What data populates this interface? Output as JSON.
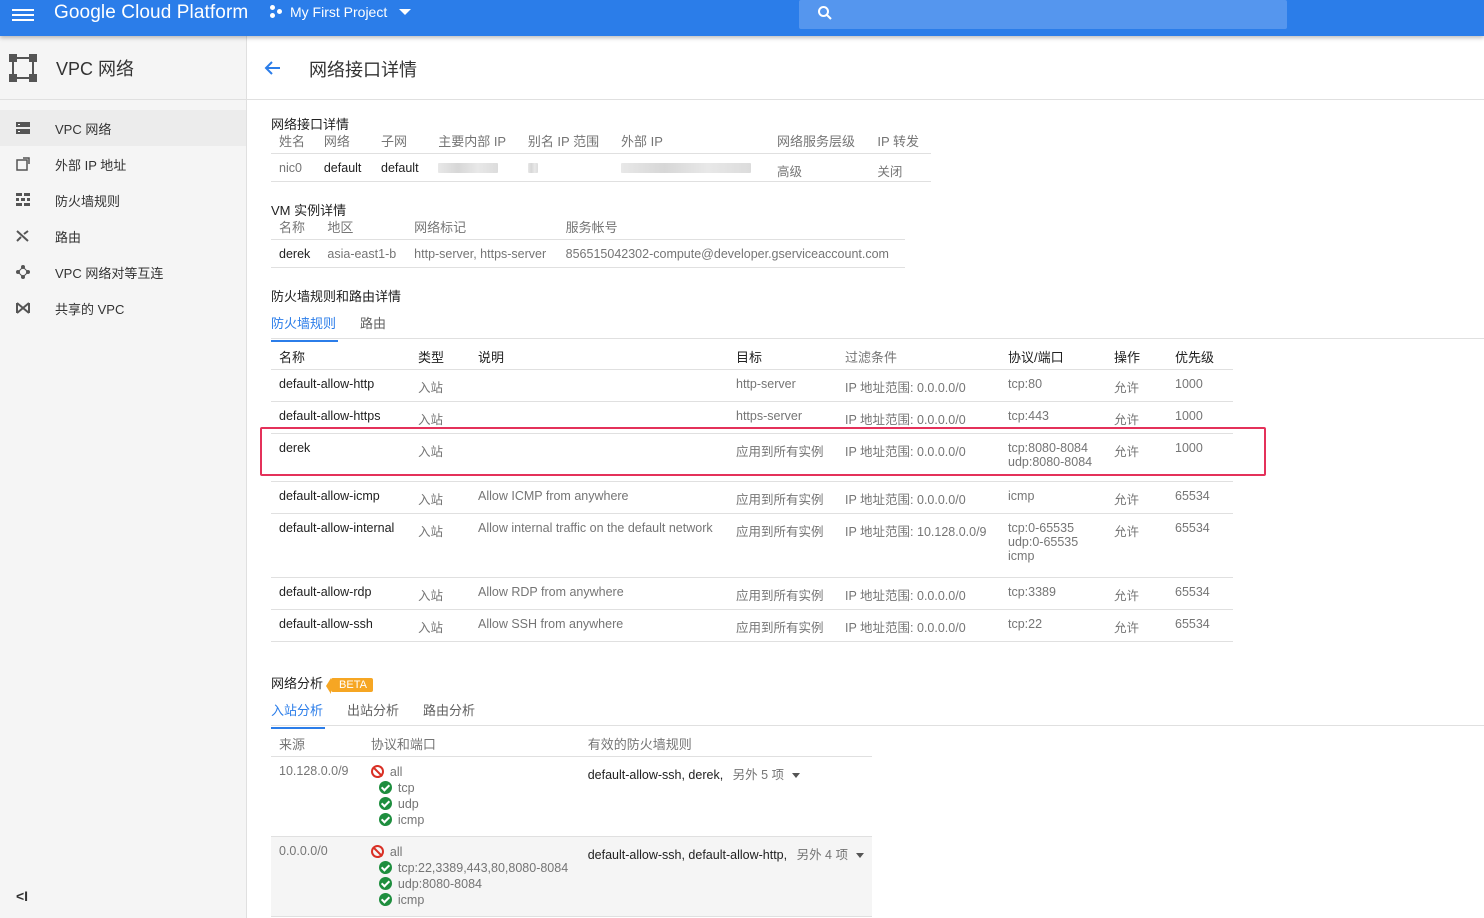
{
  "topbar": {
    "brand": "Google Cloud Platform",
    "project": "My First Project"
  },
  "sidebar": {
    "title": "VPC 网络",
    "items": [
      {
        "label": "VPC 网络",
        "icon": "vpc-networks-icon"
      },
      {
        "label": "外部 IP 地址",
        "icon": "external-ip-icon"
      },
      {
        "label": "防火墙规则",
        "icon": "firewall-icon"
      },
      {
        "label": "路由",
        "icon": "routes-icon"
      },
      {
        "label": "VPC 网络对等互连",
        "icon": "peering-icon"
      },
      {
        "label": "共享的 VPC",
        "icon": "shared-vpc-icon"
      }
    ],
    "collapse": "<I"
  },
  "header": {
    "title": "网络接口详情"
  },
  "nic": {
    "title": "网络接口详情",
    "headers": [
      "姓名",
      "网络",
      "子网",
      "主要内部 IP",
      "别名 IP 范围",
      "外部 IP",
      "网络服务层级",
      "IP 转发"
    ],
    "row": {
      "name": "nic0",
      "network": "default",
      "subnet": "default",
      "tier": "高级",
      "forwarding": "关闭"
    }
  },
  "vm": {
    "title": "VM 实例详情",
    "headers": [
      "名称",
      "地区",
      "网络标记",
      "服务帐号"
    ],
    "row": {
      "name": "derek",
      "zone": "asia-east1-b",
      "tags": "http-server, https-server",
      "account": "856515042302-compute@developer.gserviceaccount.com"
    }
  },
  "fw": {
    "title": "防火墙规则和路由详情",
    "tabs": [
      "防火墙规则",
      "路由"
    ],
    "headers": [
      "名称",
      "类型",
      "说明",
      "目标",
      "过滤条件",
      "协议/端口",
      "操作",
      "优先级"
    ],
    "rows": [
      {
        "name": "default-allow-http",
        "type": "入站",
        "desc": "",
        "target": "http-server",
        "filter": "IP 地址范围: 0.0.0.0/0",
        "ports": [
          "tcp:80"
        ],
        "action": "允许",
        "priority": "1000"
      },
      {
        "name": "default-allow-https",
        "type": "入站",
        "desc": "",
        "target": "https-server",
        "filter": "IP 地址范围: 0.0.0.0/0",
        "ports": [
          "tcp:443"
        ],
        "action": "允许",
        "priority": "1000"
      },
      {
        "name": "derek",
        "type": "入站",
        "desc": "",
        "target": "应用到所有实例",
        "filter": "IP 地址范围: 0.0.0.0/0",
        "ports": [
          "tcp:8080-8084",
          "udp:8080-8084"
        ],
        "action": "允许",
        "priority": "1000"
      },
      {
        "name": "default-allow-icmp",
        "type": "入站",
        "desc": "Allow ICMP from anywhere",
        "target": "应用到所有实例",
        "filter": "IP 地址范围: 0.0.0.0/0",
        "ports": [
          "icmp"
        ],
        "action": "允许",
        "priority": "65534"
      },
      {
        "name": "default-allow-internal",
        "type": "入站",
        "desc": "Allow internal traffic on the default network",
        "target": "应用到所有实例",
        "filter": "IP 地址范围: 10.128.0.0/9",
        "ports": [
          "tcp:0-65535",
          "udp:0-65535",
          "icmp"
        ],
        "action": "允许",
        "priority": "65534"
      },
      {
        "name": "default-allow-rdp",
        "type": "入站",
        "desc": "Allow RDP from anywhere",
        "target": "应用到所有实例",
        "filter": "IP 地址范围: 0.0.0.0/0",
        "ports": [
          "tcp:3389"
        ],
        "action": "允许",
        "priority": "65534"
      },
      {
        "name": "default-allow-ssh",
        "type": "入站",
        "desc": "Allow SSH from anywhere",
        "target": "应用到所有实例",
        "filter": "IP 地址范围: 0.0.0.0/0",
        "ports": [
          "tcp:22"
        ],
        "action": "允许",
        "priority": "65534"
      }
    ]
  },
  "analysis": {
    "title": "网络分析",
    "badge": "BETA",
    "tabs": [
      "入站分析",
      "出站分析",
      "路由分析"
    ],
    "headers": [
      "来源",
      "协议和端口",
      "有效的防火墙规则"
    ],
    "rows": [
      {
        "source": "10.128.0.0/9",
        "deny": "all",
        "allows": [
          "tcp",
          "udp",
          "icmp"
        ],
        "rules": "default-allow-ssh, derek,",
        "more": "另外 5 项"
      },
      {
        "source": "0.0.0.0/0",
        "deny": "all",
        "allows": [
          "tcp:22,3389,443,80,8080-8084",
          "udp:8080-8084",
          "icmp"
        ],
        "rules": "default-allow-ssh, default-allow-http,",
        "more": "另外 4 项"
      }
    ]
  }
}
